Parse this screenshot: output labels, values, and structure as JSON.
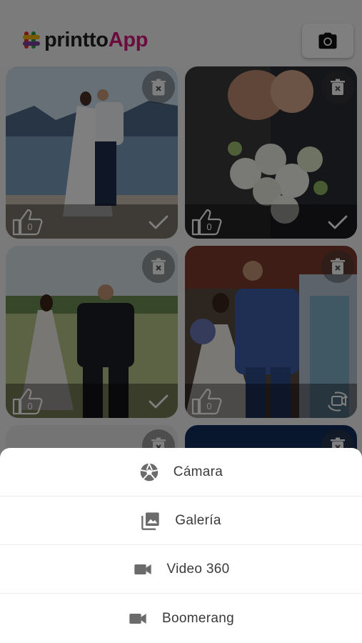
{
  "app": {
    "logo_text_dark": "printto",
    "logo_text_pink": "App",
    "camera_button_icon": "camera-icon"
  },
  "gallery": [
    {
      "photo": "wedding-couple-at-lake",
      "likes": "0",
      "status_icon": "check-icon"
    },
    {
      "photo": "wedding-bouquet-kiss",
      "likes": "0",
      "status_icon": "check-icon"
    },
    {
      "photo": "couple-walking-in-field",
      "likes": "0",
      "status_icon": "check-icon"
    },
    {
      "photo": "couple-kissing-with-guests",
      "likes": "0",
      "status_icon": "video-360-icon"
    },
    {
      "photo": "partial-photo",
      "likes": "",
      "status_icon": ""
    },
    {
      "photo": "partial-photo-dark",
      "likes": "",
      "status_icon": ""
    }
  ],
  "sheet": {
    "items": [
      {
        "label": "Cámara",
        "icon": "aperture-icon"
      },
      {
        "label": "Galería",
        "icon": "photo-library-icon"
      },
      {
        "label": "Video 360",
        "icon": "videocam-icon"
      },
      {
        "label": "Boomerang",
        "icon": "videocam-icon"
      }
    ]
  },
  "colors": {
    "brand_pink": "#d9177d",
    "overlay": "#000000",
    "sheet_bg": "#ffffff",
    "text": "#3a3a3a"
  }
}
